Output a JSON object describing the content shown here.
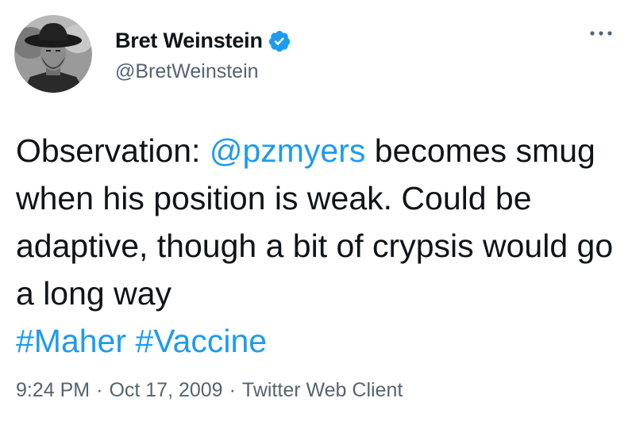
{
  "author": {
    "name": "Bret Weinstein",
    "handle": "@BretWeinstein",
    "verified": true,
    "avatar_icon": "profile-photo"
  },
  "tweet": {
    "text_prefix": "Observation: ",
    "mention": "@pzmyers",
    "text_main": " becomes smug when his position is weak. Could be adaptive, though a bit of crypsis would go a long way ",
    "hashtag_1": "#Maher",
    "hashtag_2": "#Vaccine"
  },
  "meta": {
    "time": "9:24 PM",
    "separator": "·",
    "date": "Oct 17, 2009",
    "client": "Twitter Web Client"
  },
  "colors": {
    "link": "#1d9bf0",
    "secondary_text": "#536471",
    "primary_text": "#0f1419",
    "verified_badge": "#1d9bf0"
  },
  "icons": {
    "more": "more-horizontal-icon",
    "verified": "verified-badge-icon"
  }
}
